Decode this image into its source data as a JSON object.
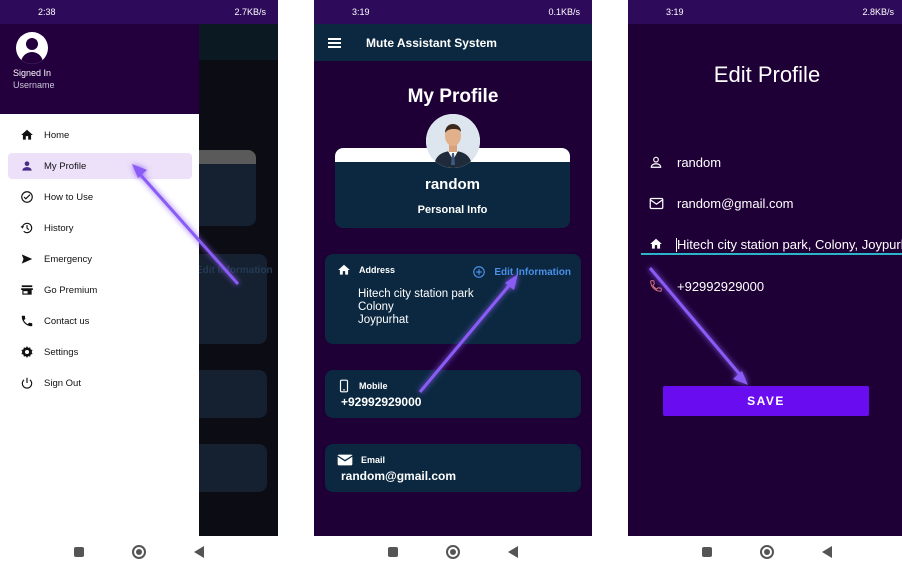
{
  "panels": [
    {
      "status": {
        "time": "2:38",
        "right": "2.7KB/s"
      },
      "background": {
        "edit_info": "Edit Information"
      },
      "drawer": {
        "signed_in": "Signed In",
        "username": "Username",
        "items": [
          {
            "label": "Home",
            "icon": "home-icon"
          },
          {
            "label": "My Profile",
            "icon": "person-icon"
          },
          {
            "label": "How to Use",
            "icon": "check-circle-icon"
          },
          {
            "label": "History",
            "icon": "history-icon"
          },
          {
            "label": "Emergency",
            "icon": "send-icon"
          },
          {
            "label": "Go Premium",
            "icon": "store-icon"
          },
          {
            "label": "Contact us",
            "icon": "phone-icon"
          },
          {
            "label": "Settings",
            "icon": "gear-icon"
          },
          {
            "label": "Sign Out",
            "icon": "power-icon"
          }
        ],
        "active_item": "My Profile"
      }
    },
    {
      "status": {
        "time": "3:19",
        "right": "0.1KB/s"
      },
      "appbar_title": "Mute Assistant System",
      "heading": "My Profile",
      "name": "random",
      "personal_info": "Personal Info",
      "address": {
        "label": "Address",
        "edit_label": "Edit Information",
        "lines": [
          "Hitech city station park",
          "Colony",
          "Joypurhat"
        ]
      },
      "mobile": {
        "label": "Mobile",
        "value": "+92992929000"
      },
      "email": {
        "label": "Email",
        "value": "random@gmail.com"
      }
    },
    {
      "status": {
        "time": "3:19",
        "right": "2.8KB/s"
      },
      "heading": "Edit Profile",
      "fields": {
        "name": "random",
        "email": "random@gmail.com",
        "address": "Hitech city station park, Colony, Joypurhat",
        "phone": "+92992929000"
      },
      "save_label": "SAVE"
    }
  ],
  "colors": {
    "app_background": "#1e0037",
    "card": "#0b2840",
    "accent": "#6a0cf0",
    "link": "#4a8fe8",
    "drawer_active": "#ede0f9",
    "annotation_arrow": "#7b3df0"
  }
}
